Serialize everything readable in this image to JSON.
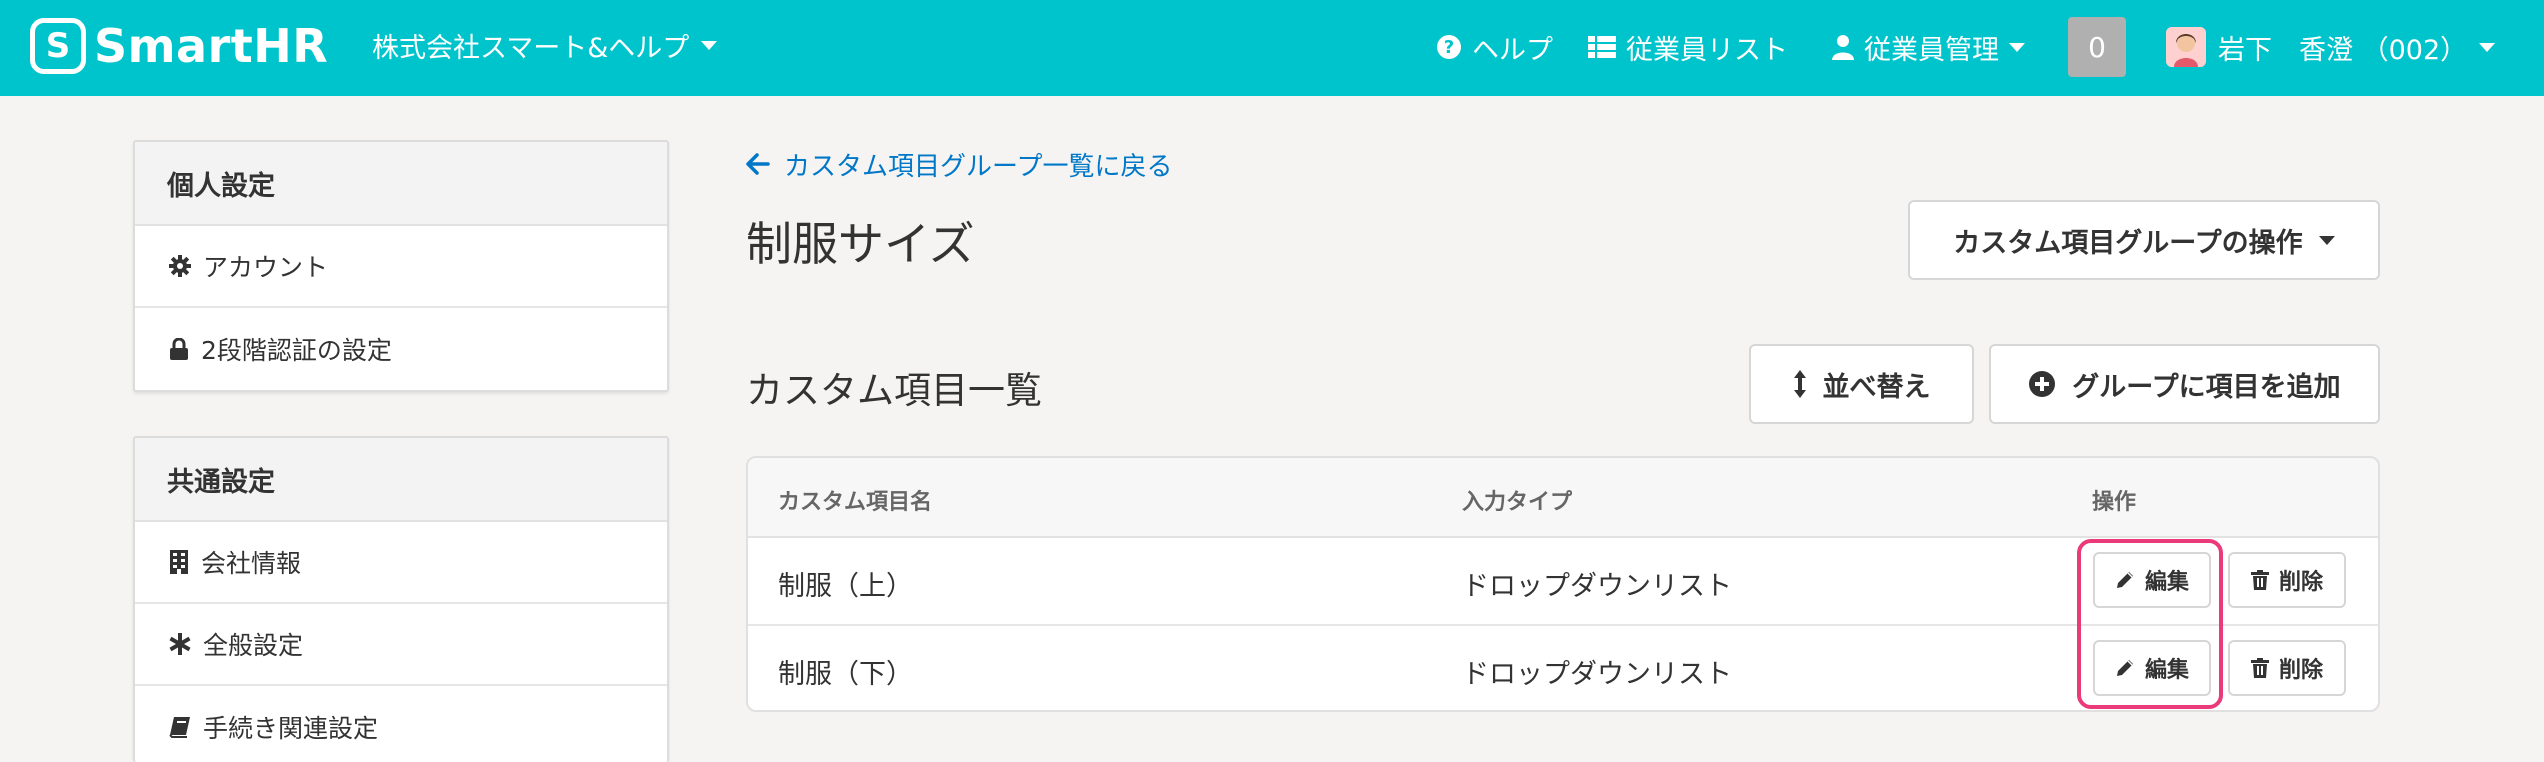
{
  "header": {
    "brand": "SmartHR",
    "brand_mark": "S",
    "company": "株式会社スマート&ヘルプ",
    "nav": {
      "help": "ヘルプ",
      "employee_list": "従業員リスト",
      "employee_mgmt": "従業員管理"
    },
    "notifications": "0",
    "user": "岩下　香澄 （002）",
    "colors": {
      "bar": "#00c4cc"
    }
  },
  "sidebar": {
    "personal": {
      "title": "個人設定",
      "items": [
        {
          "label": "アカウント",
          "icon": "gear-icon"
        },
        {
          "label": "2段階認証の設定",
          "icon": "lock-icon"
        }
      ]
    },
    "common": {
      "title": "共通設定",
      "items": [
        {
          "label": "会社情報",
          "icon": "building-icon"
        },
        {
          "label": "全般設定",
          "icon": "asterisk-icon"
        },
        {
          "label": "手続き関連設定",
          "icon": "book-icon"
        }
      ]
    }
  },
  "main": {
    "back_link": "カスタム項目グループ一覧に戻る",
    "title": "制服サイズ",
    "group_ops_button": "カスタム項目グループの操作",
    "section_title": "カスタム項目一覧",
    "sort_button": "並べ替え",
    "add_button": "グループに項目を追加",
    "table": {
      "headers": [
        "カスタム項目名",
        "入力タイプ",
        "操作"
      ],
      "rows": [
        {
          "name": "制服（上）",
          "type": "ドロップダウンリスト"
        },
        {
          "name": "制服（下）",
          "type": "ドロップダウンリスト"
        }
      ],
      "edit_label": "編集",
      "delete_label": "削除"
    },
    "highlight_color": "#ea3a7a",
    "link_color": "#0077c7"
  }
}
